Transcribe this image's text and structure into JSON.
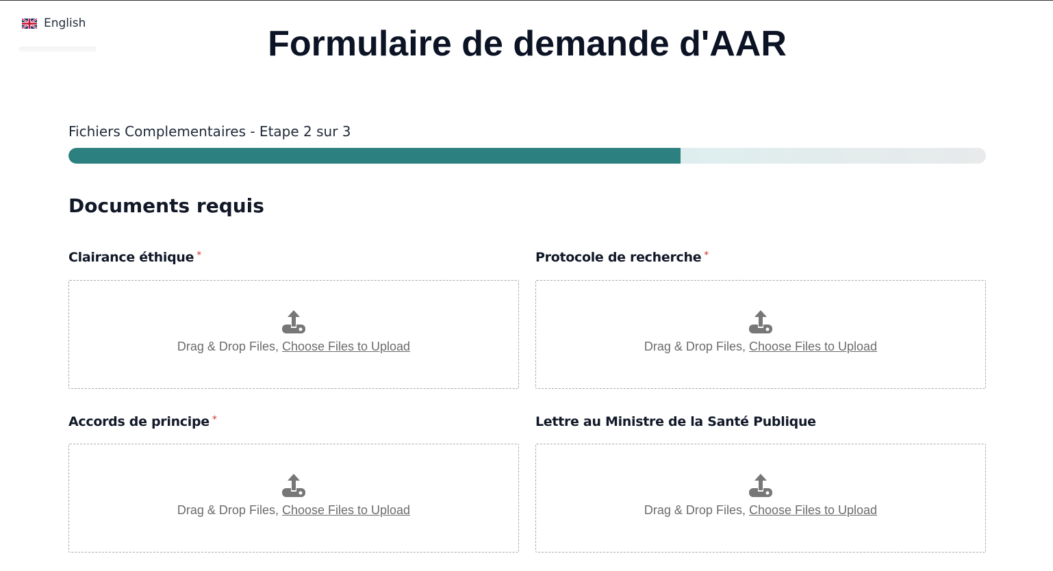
{
  "language": {
    "label": "English",
    "flag_icon": "uk-flag-icon"
  },
  "page_title": "Formulaire de demande d'AAR",
  "step": {
    "label": "Fichiers Complementaires - Etape 2 sur 3",
    "progress": 0.667
  },
  "colors": {
    "accent": "#2d8080",
    "required": "#d0342c"
  },
  "section_title": "Documents requis",
  "fields": [
    {
      "label": "Clairance éthique",
      "required": "*",
      "drop_text": "Drag & Drop Files,",
      "link_text": "Choose Files to Upload"
    },
    {
      "label": "Protocole de recherche",
      "required": "*",
      "drop_text": "Drag & Drop Files,",
      "link_text": "Choose Files to Upload"
    },
    {
      "label": "Accords de principe",
      "required": "*",
      "drop_text": "Drag & Drop Files,",
      "link_text": "Choose Files to Upload"
    },
    {
      "label": "Lettre au Ministre de la Santé Publique",
      "required": "",
      "drop_text": "Drag & Drop Files,",
      "link_text": "Choose Files to Upload"
    }
  ]
}
